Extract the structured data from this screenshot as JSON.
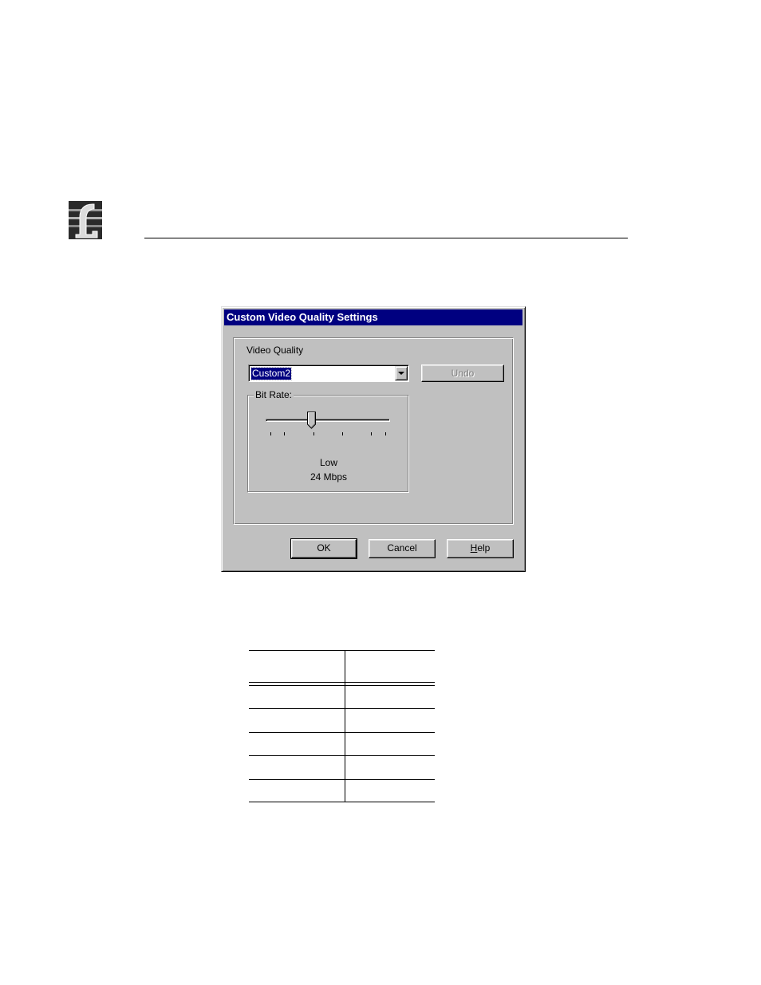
{
  "dialog": {
    "title": "Custom Video Quality Settings",
    "video_quality_label": "Video Quality",
    "video_quality_value": "Custom2",
    "undo_label": "Undo",
    "bit_rate_group_label": "Bit Rate:",
    "bit_rate": {
      "slider_fraction": 0.37,
      "level_text": "Low",
      "rate_text": "24 Mbps"
    },
    "buttons": {
      "ok_label": "OK",
      "cancel_label": "Cancel",
      "help_label": "Help",
      "help_mnemonic": "H",
      "help_rest": "elp"
    }
  },
  "colors": {
    "titlebar": "#000080",
    "dialog_face": "#c0c0c0",
    "selection": "#000080"
  },
  "table": {
    "header": [
      "",
      ""
    ],
    "rows": [
      [
        "",
        ""
      ],
      [
        "",
        ""
      ],
      [
        "",
        ""
      ],
      [
        "",
        ""
      ],
      [
        "",
        ""
      ]
    ]
  }
}
